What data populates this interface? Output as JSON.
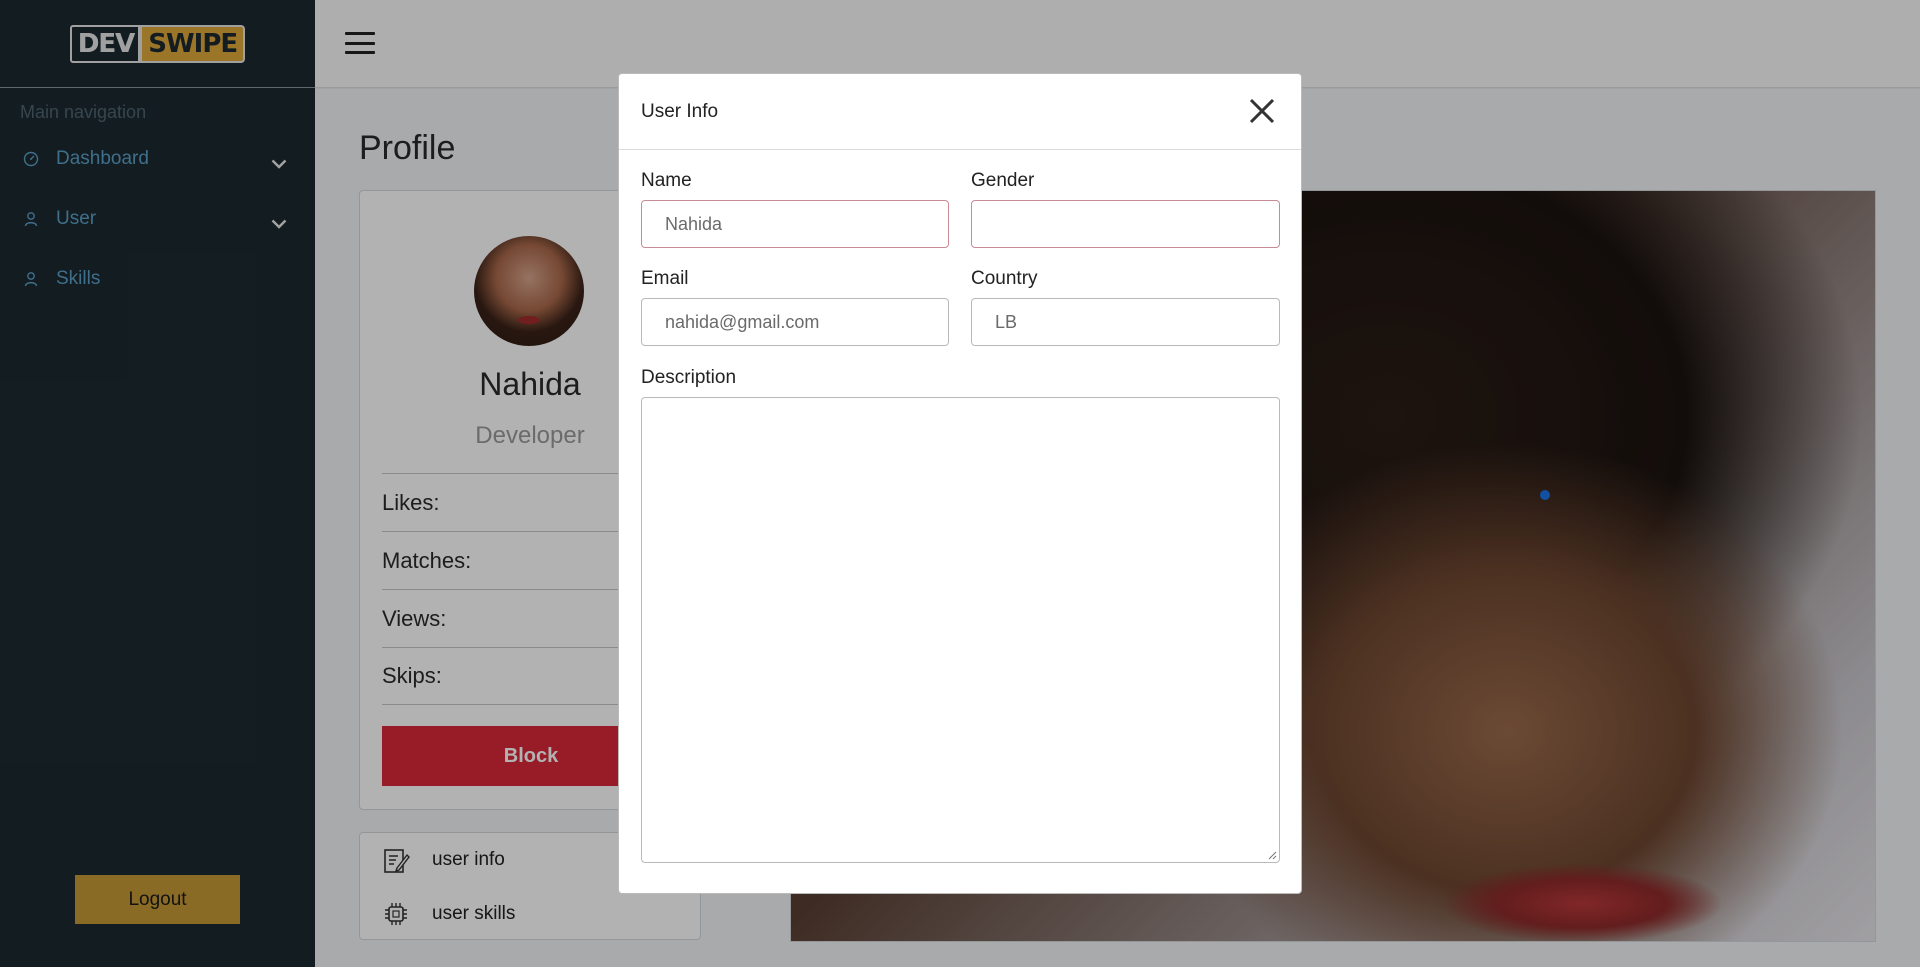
{
  "brand": {
    "logo_left": "DEV",
    "logo_right": "SWIPE"
  },
  "sidebar": {
    "caption": "Main navigation",
    "items": [
      {
        "label": "Dashboard",
        "icon": "dashboard-icon",
        "has_submenu": true
      },
      {
        "label": "User",
        "icon": "user-icon",
        "has_submenu": true
      },
      {
        "label": "Skills",
        "icon": "user-icon",
        "has_submenu": false
      }
    ],
    "logout_label": "Logout"
  },
  "page": {
    "title": "Profile",
    "profile": {
      "name": "Nahida",
      "role": "Developer",
      "stats": [
        {
          "label": "Likes:"
        },
        {
          "label": "Matches:"
        },
        {
          "label": "Views:"
        },
        {
          "label": "Skips:"
        }
      ],
      "block_label": "Block"
    },
    "links": [
      {
        "label": "user info",
        "icon": "edit-notes-icon"
      },
      {
        "label": "user skills",
        "icon": "chip-icon"
      }
    ]
  },
  "modal": {
    "title": "User Info",
    "fields": {
      "name": {
        "label": "Name",
        "value": "Nahida"
      },
      "gender": {
        "label": "Gender",
        "value": ""
      },
      "email": {
        "label": "Email",
        "value": "nahida@gmail.com"
      },
      "country": {
        "label": "Country",
        "value": "LB"
      },
      "description": {
        "label": "Description",
        "value": ""
      }
    }
  },
  "colors": {
    "sidebar_bg": "#1c2a30",
    "nav_link": "#5b9fc7",
    "logout_bg": "#c69a36",
    "block_bg": "#d9293a",
    "logo_accent": "#e0a93a"
  }
}
